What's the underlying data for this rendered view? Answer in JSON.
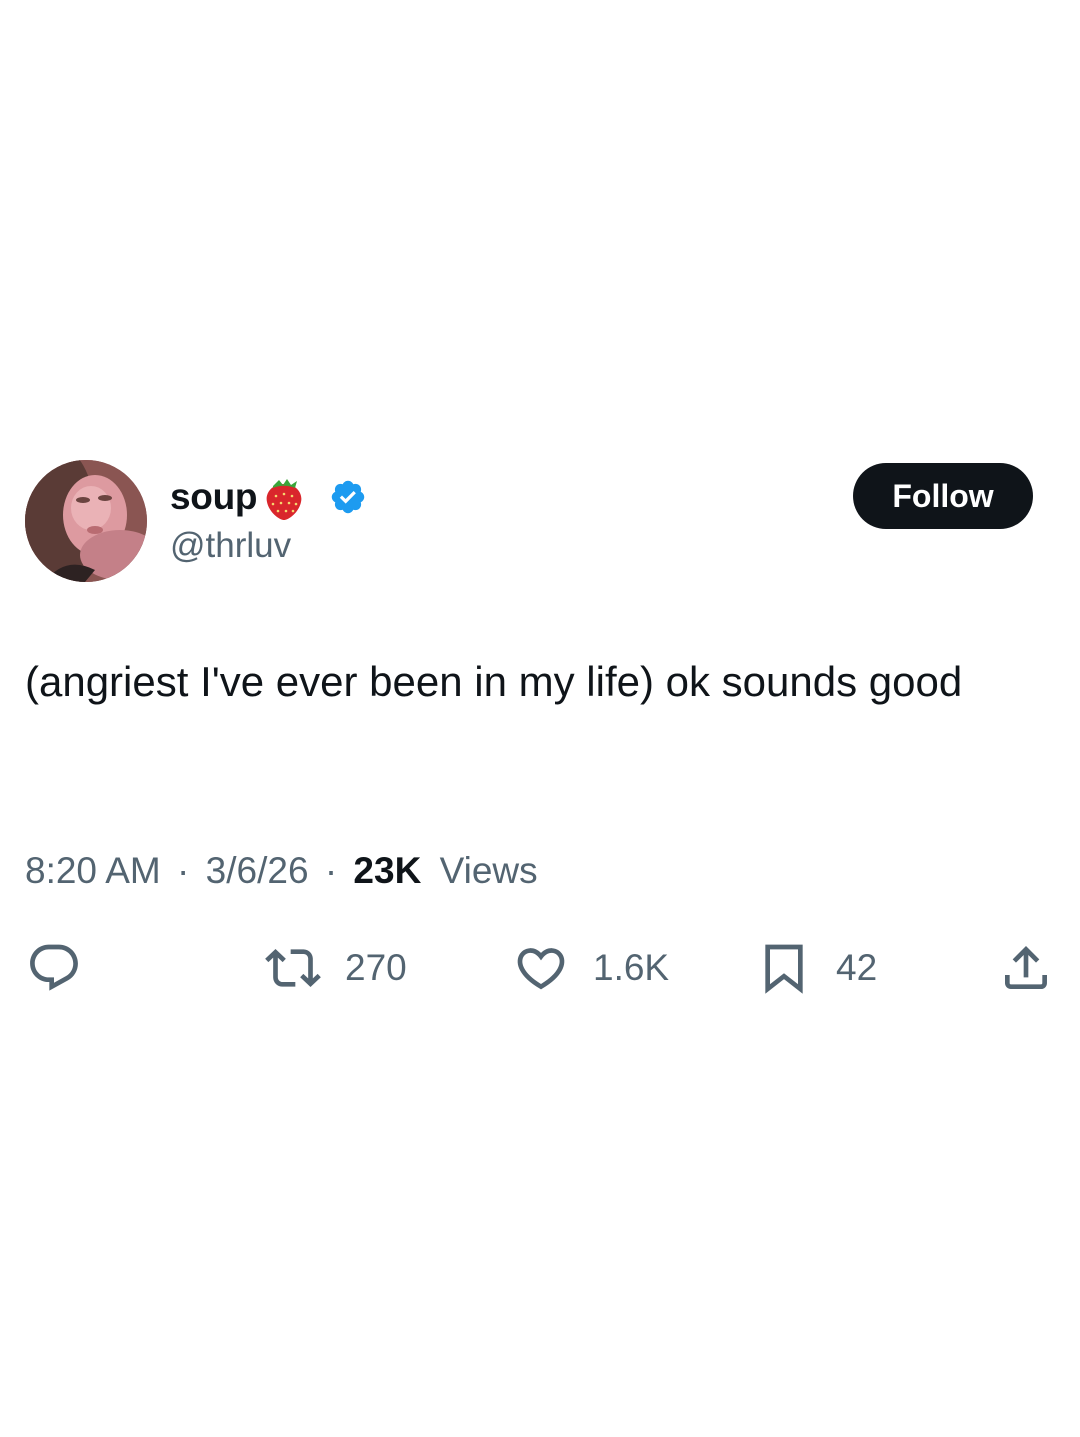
{
  "author": {
    "display_name": "soup",
    "name_emoji": "strawberry-emoji",
    "verified": true,
    "handle": "@thrluv"
  },
  "follow_label": "Follow",
  "tweet": {
    "text": "(angriest I've ever been in my life) ok sounds good",
    "time": "8:20 AM",
    "date": "3/6/26",
    "separator": "·",
    "views_count": "23K",
    "views_label": "Views"
  },
  "actions": {
    "reply": {
      "icon": "reply-icon"
    },
    "retweet": {
      "icon": "retweet-icon",
      "count": "270"
    },
    "like": {
      "icon": "heart-icon",
      "count": "1.6K"
    },
    "bookmark": {
      "icon": "bookmark-icon",
      "count": "42"
    },
    "share": {
      "icon": "share-icon"
    }
  },
  "colors": {
    "text_primary": "#0f1419",
    "text_secondary": "#536471",
    "verified_blue": "#1d9bf0",
    "button_bg": "#0f1419",
    "button_text": "#ffffff",
    "background": "#ffffff"
  }
}
